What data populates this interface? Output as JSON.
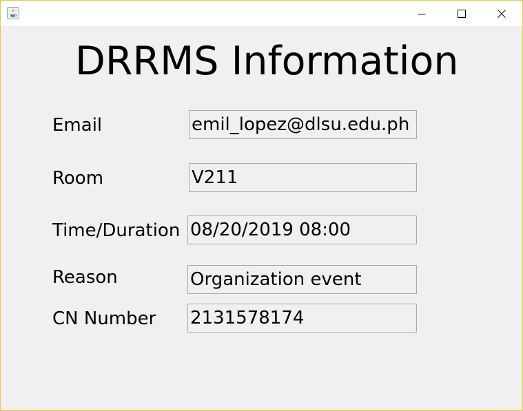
{
  "window": {
    "controls": {
      "minimize_icon": "minimize-icon",
      "maximize_icon": "maximize-icon",
      "close_icon": "close-icon"
    }
  },
  "form": {
    "title": "DRRMS Information",
    "fields": [
      {
        "label": "Email",
        "value": "emil_lopez@dlsu.edu.ph"
      },
      {
        "label": "Room",
        "value": "V211"
      },
      {
        "label": "Time/Duration",
        "value": "08/20/2019 08:00"
      },
      {
        "label": "Reason",
        "value": "Organization event"
      },
      {
        "label": "CN Number",
        "value": "2131578174"
      }
    ]
  },
  "colors": {
    "window_border": "#e6c84a",
    "background": "#f0f0f0",
    "field_border": "#a9a9a9"
  }
}
